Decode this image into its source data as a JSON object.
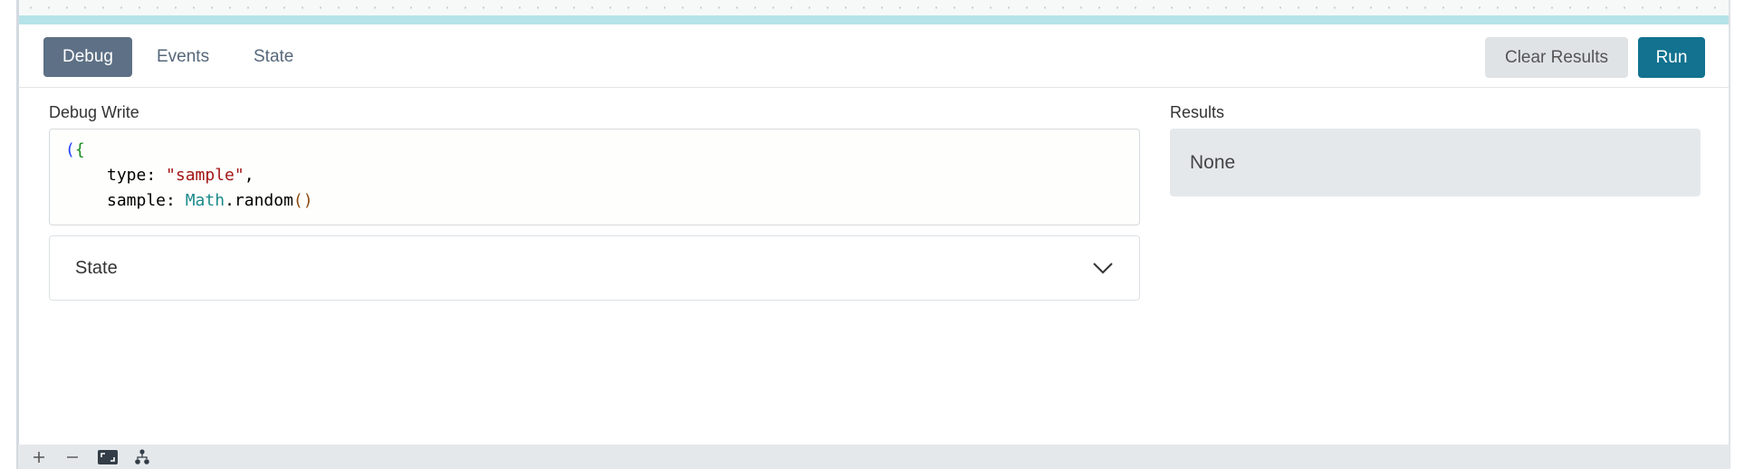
{
  "toolbar": {
    "tabs": [
      {
        "label": "Debug",
        "active": true
      },
      {
        "label": "Events",
        "active": false
      },
      {
        "label": "State",
        "active": false
      }
    ],
    "clear_label": "Clear Results",
    "run_label": "Run"
  },
  "debug_write": {
    "label": "Debug Write",
    "code": {
      "open": "({",
      "line1_key": "type: ",
      "line1_value": "\"sample\"",
      "line1_comma": ",",
      "line2_key": "sample: ",
      "line2_obj": "Math",
      "line2_method": ".random",
      "line2_parens": "()"
    }
  },
  "state_accordion": {
    "label": "State",
    "icon": "chevron-down-icon"
  },
  "results": {
    "label": "Results",
    "value": "None"
  },
  "bottom_bar": {
    "icons": [
      "zoom-in-icon",
      "zoom-out-icon",
      "fit-screen-icon",
      "hierarchy-icon"
    ]
  },
  "colors": {
    "accent": "#12728f",
    "active_tab": "#5d7085",
    "teal_strip": "#b5e3e8"
  }
}
